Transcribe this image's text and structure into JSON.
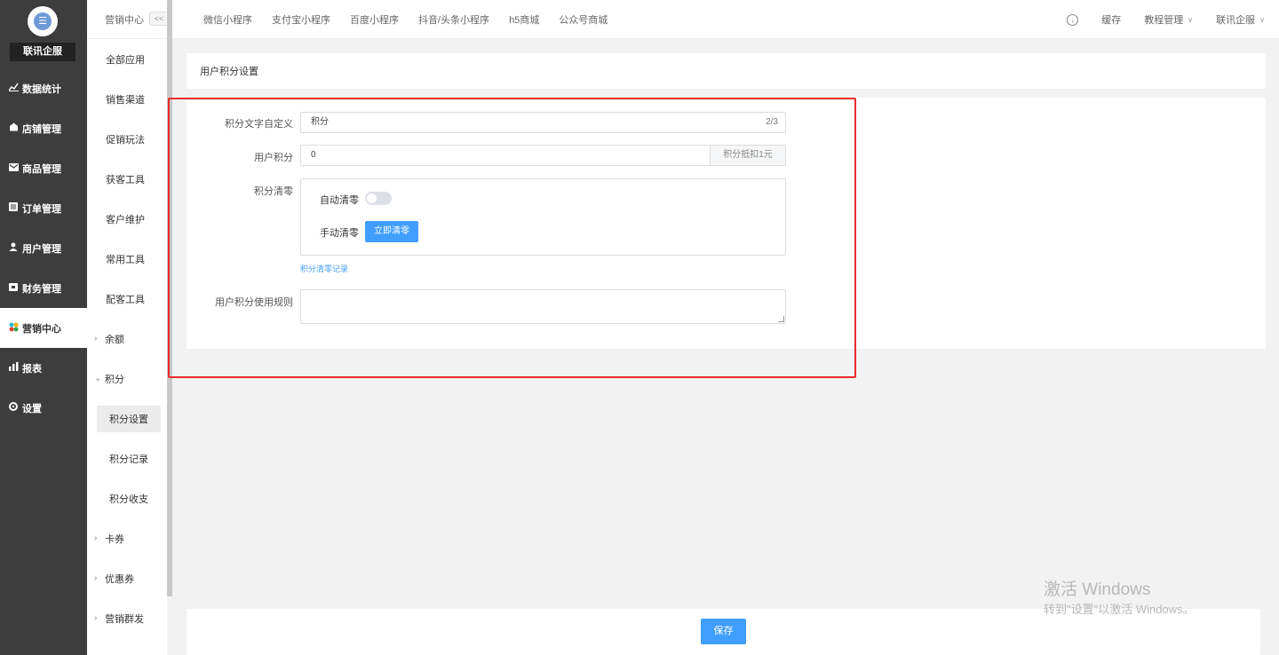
{
  "sidebar": {
    "brand": "联讯企服",
    "items": [
      {
        "label": "数据统计",
        "icon": "line-chart-icon"
      },
      {
        "label": "店铺管理",
        "icon": "store-icon"
      },
      {
        "label": "商品管理",
        "icon": "mail-icon"
      },
      {
        "label": "订单管理",
        "icon": "list-icon"
      },
      {
        "label": "用户管理",
        "icon": "user-icon"
      },
      {
        "label": "财务管理",
        "icon": "wallet-icon"
      },
      {
        "label": "营销中心",
        "icon": "marketing-icon",
        "active": true
      },
      {
        "label": "报表",
        "icon": "bar-chart-icon"
      },
      {
        "label": "设置",
        "icon": "gear-icon"
      }
    ]
  },
  "submenu": {
    "title": "营销中心",
    "collapse": "<<",
    "items": [
      "全部应用",
      "销售渠道",
      "促销玩法",
      "获客工具",
      "客户维护",
      "常用工具",
      "配客工具"
    ],
    "group_balance": "余额",
    "group_points": "积分",
    "points_children": [
      "积分设置",
      "积分记录",
      "积分收支"
    ],
    "group_cards": "卡券",
    "group_coupons": "优惠券",
    "group_mass": "营销群发"
  },
  "topbar": {
    "tabs": [
      "微信小程序",
      "支付宝小程序",
      "百度小程序",
      "抖音/头条小程序",
      "h5商城",
      "公众号商城"
    ],
    "cache": "缓存",
    "tutorial": "教程管理",
    "account": "联讯企服"
  },
  "page": {
    "title": "用户积分设置"
  },
  "form": {
    "points_text_label": "积分文字自定义",
    "points_text_value": "积分",
    "points_text_counter": "2/3",
    "user_points_label": "用户积分",
    "user_points_value": "0",
    "user_points_addon": "积分抵扣1元",
    "clear_label": "积分清零",
    "auto_clear_label": "自动清零",
    "auto_clear_on": false,
    "manual_clear_label": "手动清零",
    "manual_clear_button": "立即清零",
    "clear_records_link": "积分清零记录",
    "rules_label": "用户积分使用规则",
    "rules_value": ""
  },
  "footer": {
    "save_button": "保存"
  },
  "watermark": {
    "title": "激活 Windows",
    "subtitle": "转到\"设置\"以激活 Windows。"
  },
  "colors": {
    "sidebar_bg": "#3d3d3d",
    "primary": "#409eff",
    "highlight": "#ec2b2b"
  }
}
